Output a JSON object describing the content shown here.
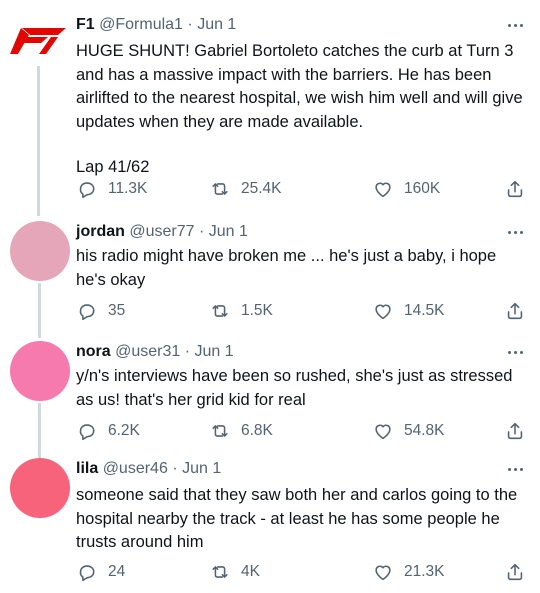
{
  "tweets": [
    {
      "name": "F1",
      "handle": "@Formula1",
      "date": "Jun 1",
      "avatar": "f1-logo",
      "paragraphs": [
        "HUGE SHUNT! Gabriel Bortoleto catches the curb at Turn 3 and has a massive impact with the barriers. He has been airlifted to the nearest hospital, we wish him well and will give updates when they are made available.",
        "Lap 41/62"
      ],
      "replies": "11.3K",
      "retweets": "25.4K",
      "likes": "160K"
    },
    {
      "name": "jordan",
      "handle": "@user77",
      "date": "Jun 1",
      "avatar_color": "#e4a6b8",
      "paragraphs": [
        "his radio might have broken me ... he's just a baby, i hope he's okay"
      ],
      "replies": "35",
      "retweets": "1.5K",
      "likes": "14.5K"
    },
    {
      "name": "nora",
      "handle": "@user31",
      "date": "Jun 1",
      "avatar_color": "#f77aae",
      "paragraphs": [
        "y/n's interviews have been so rushed, she's just as stressed as us! that's her grid kid for real"
      ],
      "replies": "6.2K",
      "retweets": "6.8K",
      "likes": "54.8K"
    },
    {
      "name": "lila",
      "handle": "@user46",
      "date": "Jun 1",
      "avatar_color": "#f7637a",
      "paragraphs": [
        "someone said that they saw both her and carlos going to the hospital nearby the track - at least he has some people he trusts around him"
      ],
      "replies": "24",
      "retweets": "4K",
      "likes": "21.3K"
    }
  ],
  "colors": {
    "f1_red": "#e10600",
    "thread_line": "#cfd9de",
    "secondary_text": "#536471",
    "primary_text": "#0f1419"
  },
  "separator": "·"
}
